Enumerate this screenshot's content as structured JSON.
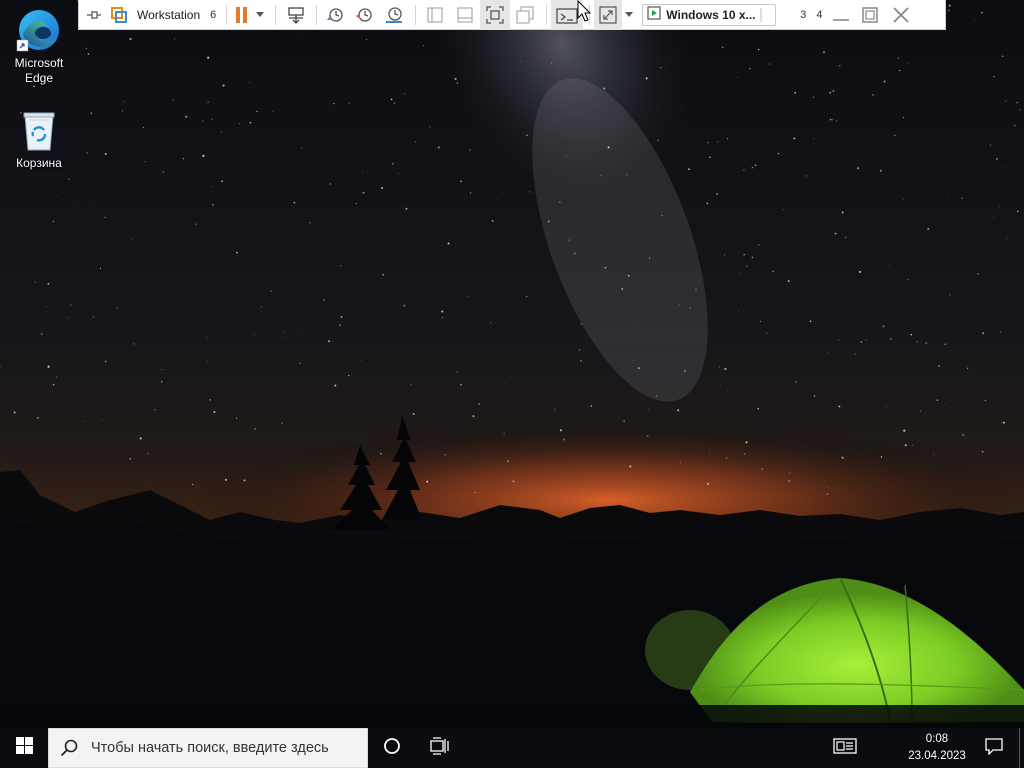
{
  "desktop": {
    "icons": [
      {
        "label_line1": "Microsoft",
        "label_line2": "Edge",
        "icon": "edge-icon"
      },
      {
        "label": "Корзина",
        "icon": "recycle-bin-icon"
      }
    ]
  },
  "vm_toolbar": {
    "title": "Workstation",
    "title_badge": "6",
    "vm_tab_label": "Windows 10 x...",
    "window_badges": [
      "3",
      "4"
    ],
    "icons": [
      "pin-icon",
      "vmware-logo-icon",
      "pause-icon",
      "dropdown-arrow-icon",
      "send-ctrl-alt-del-icon",
      "snapshot-icon",
      "revert-snapshot-icon",
      "snapshot-manager-icon",
      "single-window-icon",
      "hide-thumbnail-icon",
      "full-screen-icon",
      "unity-icon",
      "console-view-icon",
      "stretch-icon",
      "minimize-icon",
      "restore-icon",
      "close-icon"
    ]
  },
  "taskbar": {
    "search_placeholder": "Чтобы начать поиск, введите здесь",
    "time": "0:08",
    "date": "23.04.2023",
    "icons": [
      "windows-start-icon",
      "search-icon",
      "cortana-icon",
      "task-view-icon",
      "news-and-interests-icon",
      "notification-icon"
    ]
  },
  "colors": {
    "taskbar_bg": "#0b0c10",
    "search_bg": "#f3f3f3",
    "pause_orange": "#e8762d",
    "tent_green": "#8ee22c",
    "horizon_orange": "#d8581d"
  }
}
